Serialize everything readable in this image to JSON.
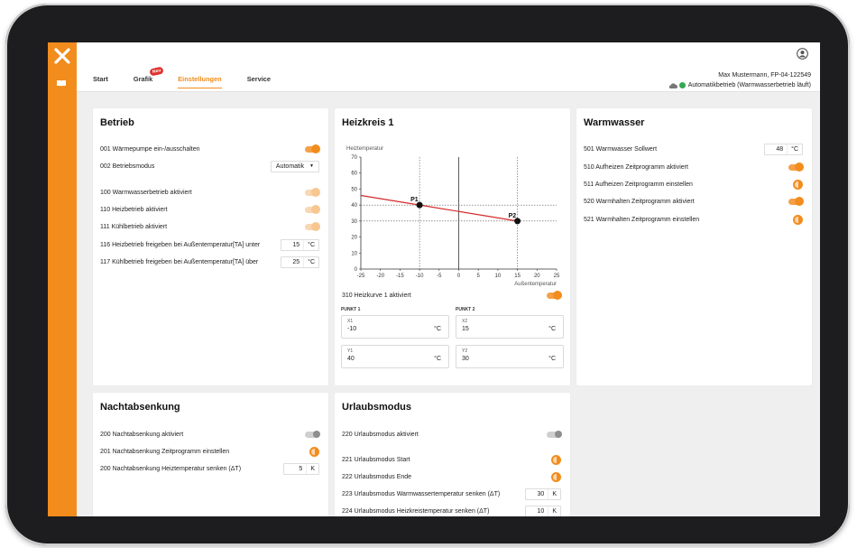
{
  "header": {
    "tabs": [
      {
        "label": "Start"
      },
      {
        "label": "Grafik",
        "badge": "Neu"
      },
      {
        "label": "Einstellungen"
      },
      {
        "label": "Service"
      }
    ],
    "user": "Max Mustermann, FP-04-122549",
    "status": "Automatikbetrieb (Warmwasserbetrieb läuft)"
  },
  "betrieb": {
    "title": "Betrieb",
    "rows": [
      {
        "label": "001  Wärmepumpe ein-/ausschalten"
      },
      {
        "label": "002  Betriebsmodus",
        "select": "Automatik"
      },
      {
        "label": "100  Warmwasserbetrieb aktiviert"
      },
      {
        "label": "110  Heizbetrieb aktiviert"
      },
      {
        "label": "111  Kühlbetrieb aktiviert"
      },
      {
        "label": "116  Heizbetrieb freigeben bei Außentemperatur[TA] unter",
        "value": "15",
        "unit": "°C"
      },
      {
        "label": "117  Kühlbetrieb freigeben bei Außentemperatur[TA] über",
        "value": "25",
        "unit": "°C"
      }
    ]
  },
  "heizkreis": {
    "title": "Heizkreis 1",
    "curve_label": "310 Heizkurve 1 aktiviert",
    "punkt1": {
      "title": "PUNKT 1",
      "x_key": "X1",
      "x": "-10",
      "y_key": "Y1",
      "y": "40",
      "unit": "°C"
    },
    "punkt2": {
      "title": "PUNKT 2",
      "x_key": "X2",
      "x": "15",
      "y_key": "Y2",
      "y": "30",
      "unit": "°C"
    }
  },
  "chart_data": {
    "type": "line",
    "title": "",
    "ylabel": "Heiztemperatur",
    "xlabel": "Außentemperatur",
    "xlim": [
      -25,
      25
    ],
    "ylim": [
      0,
      70
    ],
    "xticks": [
      "-25",
      "-20",
      "-15",
      "-10",
      "-5",
      "0",
      "5",
      "10",
      "15",
      "20",
      "25"
    ],
    "yticks": [
      "0",
      "10",
      "20",
      "30",
      "40",
      "50",
      "60",
      "70"
    ],
    "series": [
      {
        "x": [
          -25,
          -10,
          15
        ],
        "y": [
          46,
          40,
          30
        ]
      }
    ],
    "points": [
      {
        "label": "P1",
        "x": -10,
        "y": 40
      },
      {
        "label": "P2",
        "x": 15,
        "y": 30
      }
    ],
    "grid": false,
    "line_color": "#d42a2a"
  },
  "warmwasser": {
    "title": "Warmwasser",
    "rows": [
      {
        "label": "501  Warmwasser Sollwert",
        "value": "48",
        "unit": "°C"
      },
      {
        "label": "510  Aufheizen Zeitprogramm aktiviert"
      },
      {
        "label": "511  Aufheizen Zeitprogramm einstellen"
      },
      {
        "label": "520  Warmhalten Zeitprogramm aktiviert"
      },
      {
        "label": "521  Warmhalten Zeitprogramm einstellen"
      }
    ]
  },
  "nacht": {
    "title": "Nachtabsenkung",
    "rows": [
      {
        "label": "200  Nachtabsenkung aktiviert"
      },
      {
        "label": "201  Nachtabsenkung Zeitprogramm einstellen"
      },
      {
        "label": "200  Nachtabsenkung Heiztemperatur senken (ΔT)",
        "value": "5",
        "unit": "K"
      }
    ]
  },
  "urlaub": {
    "title": "Urlaubsmodus",
    "rows": [
      {
        "label": "220  Urlaubsmodus aktiviert"
      },
      {
        "label": "221  Urlaubsmodus Start"
      },
      {
        "label": "222  Urlaubsmodus Ende"
      },
      {
        "label": "223  Urlaubsmodus Warmwassertemperatur senken (ΔT)",
        "value": "30",
        "unit": "K"
      },
      {
        "label": "224  Urlaubsmodus Heizkreistemperatur senken (ΔT)",
        "value": "10",
        "unit": "K"
      }
    ]
  },
  "colors": {
    "accent": "#f28c1d",
    "status_ok": "#35a852"
  }
}
